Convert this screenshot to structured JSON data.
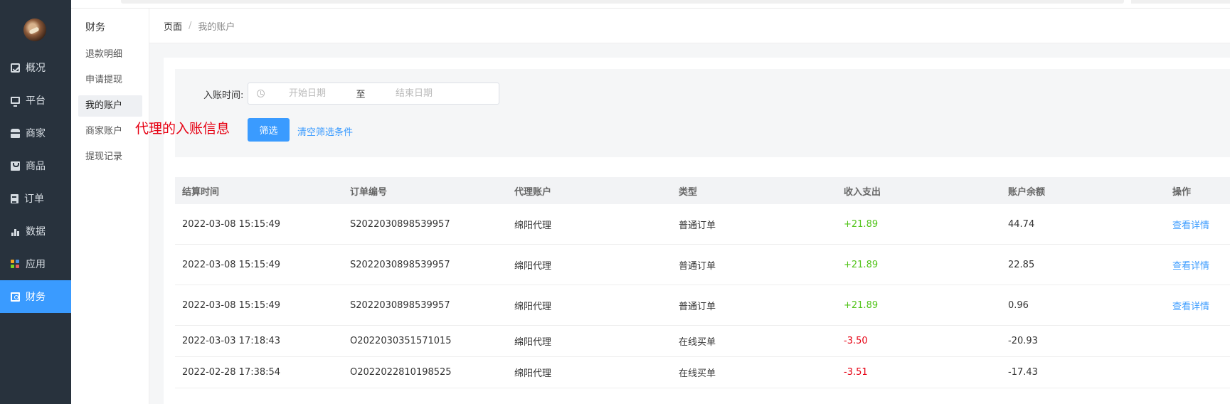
{
  "sidebar": {
    "items": [
      {
        "label": "概况",
        "icon": "chart-icon"
      },
      {
        "label": "平台",
        "icon": "monitor-icon"
      },
      {
        "label": "商家",
        "icon": "shop-icon"
      },
      {
        "label": "商品",
        "icon": "bag-icon"
      },
      {
        "label": "订单",
        "icon": "document-icon"
      },
      {
        "label": "数据",
        "icon": "bar-chart-icon"
      },
      {
        "label": "应用",
        "icon": "apps-icon"
      },
      {
        "label": "财务",
        "icon": "cash-icon",
        "active": true
      }
    ]
  },
  "subnav": {
    "title": "财务",
    "items": [
      "退款明细",
      "申请提现",
      "我的账户",
      "商家账户",
      "提现记录"
    ],
    "active_index": 2
  },
  "breadcrumb": {
    "root": "页面",
    "separator": "/",
    "current": "我的账户"
  },
  "filter": {
    "label": "入账时间:",
    "start_placeholder": "开始日期",
    "to": "至",
    "end_placeholder": "结束日期",
    "filter_button": "筛选",
    "clear_link": "清空筛选条件"
  },
  "annotation": "代理的入账信息",
  "table": {
    "headers": [
      "结算时间",
      "订单编号",
      "代理账户",
      "类型",
      "收入支出",
      "账户余额",
      "操作"
    ],
    "rows": [
      {
        "time": "2022-03-08 15:15:49",
        "order": "S2022030898539957",
        "agent": "绵阳代理",
        "type": "普通订单",
        "amount": "+21.89",
        "balance": "44.74",
        "action": "查看详情"
      },
      {
        "time": "2022-03-08 15:15:49",
        "order": "S2022030898539957",
        "agent": "绵阳代理",
        "type": "普通订单",
        "amount": "+21.89",
        "balance": "22.85",
        "action": "查看详情"
      },
      {
        "time": "2022-03-08 15:15:49",
        "order": "S2022030898539957",
        "agent": "绵阳代理",
        "type": "普通订单",
        "amount": "+21.89",
        "balance": "0.96",
        "action": "查看详情"
      },
      {
        "time": "2022-03-03 17:18:43",
        "order": "O2022030351571015",
        "agent": "绵阳代理",
        "type": "在线买单",
        "amount": "-3.50",
        "balance": "-20.93",
        "action": ""
      },
      {
        "time": "2022-02-28 17:38:54",
        "order": "O2022022810198525",
        "agent": "绵阳代理",
        "type": "在线买单",
        "amount": "-3.51",
        "balance": "-17.43",
        "action": ""
      }
    ]
  },
  "colors": {
    "accent": "#3a9bff",
    "sidebar_bg": "#28323d",
    "positive": "#52c41a",
    "negative": "#e60012"
  }
}
